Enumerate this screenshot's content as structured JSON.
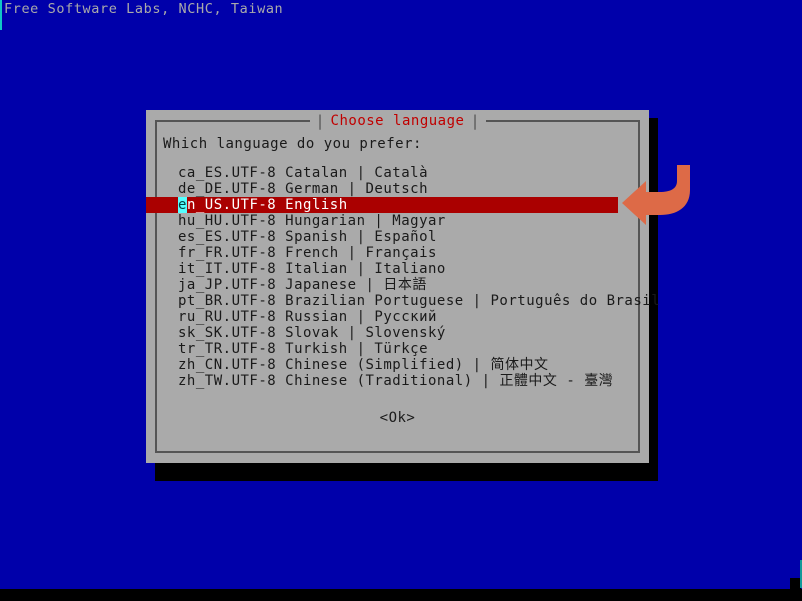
{
  "console": {
    "banner": "Free Software Labs, NCHC, Taiwan"
  },
  "dialog": {
    "title": "Choose language",
    "title_separator_left": "|",
    "title_separator_right": "|",
    "prompt": "Which language do you prefer:",
    "ok_label": "<Ok>",
    "selected_index": 2,
    "items": [
      {
        "locale": "ca_ES.UTF-8",
        "label": "Catalan | Català"
      },
      {
        "locale": "de_DE.UTF-8",
        "label": "German | Deutsch"
      },
      {
        "locale": "en_US.UTF-8",
        "label": "English"
      },
      {
        "locale": "hu_HU.UTF-8",
        "label": "Hungarian | Magyar"
      },
      {
        "locale": "es_ES.UTF-8",
        "label": "Spanish | Español"
      },
      {
        "locale": "fr_FR.UTF-8",
        "label": "French | Français"
      },
      {
        "locale": "it_IT.UTF-8",
        "label": "Italian | Italiano"
      },
      {
        "locale": "ja_JP.UTF-8",
        "label": "Japanese | 日本語"
      },
      {
        "locale": "pt_BR.UTF-8",
        "label": "Brazilian Portuguese | Português do Brasil"
      },
      {
        "locale": "ru_RU.UTF-8",
        "label": "Russian | Русский"
      },
      {
        "locale": "sk_SK.UTF-8",
        "label": "Slovak | Slovenský"
      },
      {
        "locale": "tr_TR.UTF-8",
        "label": "Turkish | Türkçe"
      },
      {
        "locale": "zh_CN.UTF-8",
        "label": "Chinese (Simplified) | 简体中文"
      },
      {
        "locale": "zh_TW.UTF-8",
        "label": "Chinese (Traditional) | 正體中文 - 臺灣"
      }
    ]
  },
  "annotation": {
    "arrow_name": "curved-arrow-pointing-left",
    "color": "#dd6a47"
  },
  "colors": {
    "screen_background": "#0000aa",
    "dialog_background": "#aaaaaa",
    "dialog_border": "#555555",
    "title_text": "#c00000",
    "selection_background": "#aa0000",
    "selection_text": "#ffffff",
    "cursor_background": "#55ffff",
    "banner_text": "#aaaaaa",
    "shadow": "#000000"
  }
}
